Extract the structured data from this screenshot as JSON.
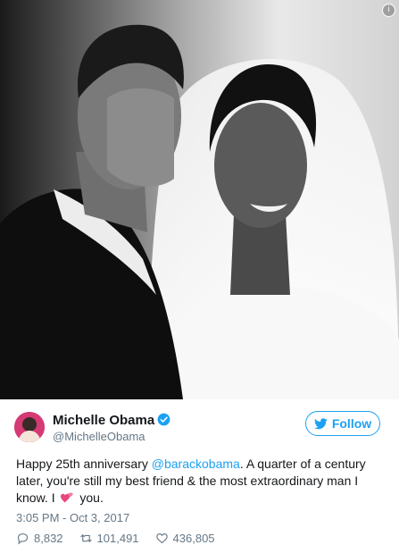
{
  "photo": {
    "alt": "wedding photo",
    "info_icon": "info-icon"
  },
  "tweet": {
    "author_name": "Michelle Obama",
    "author_handle": "@MichelleObama",
    "follow_label": "Follow",
    "text_prefix": "Happy 25th anniversary ",
    "mention": "@barackobama",
    "text_middle": ". A quarter of a century later, you're still my best friend & the most extraordinary man I know. I",
    "text_suffix": " you.",
    "timestamp": "3:05 PM - Oct 3, 2017",
    "replies": "8,832",
    "retweets": "101,491",
    "likes": "436,805"
  },
  "colors": {
    "accent": "#1da1f2",
    "muted": "#657786",
    "text": "#14171a",
    "heart_emoji": "#e8477c"
  }
}
